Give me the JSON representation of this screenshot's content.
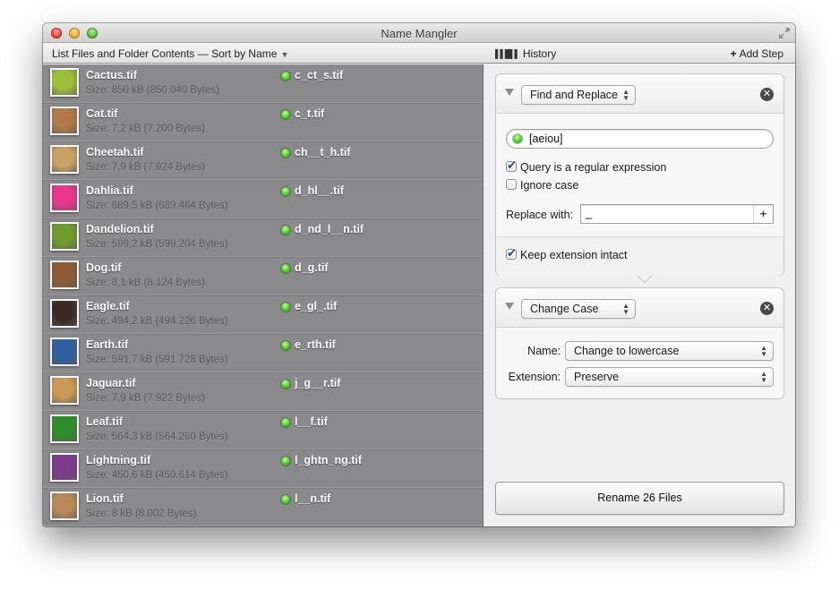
{
  "window": {
    "title": "Name Mangler",
    "controls": [
      "close",
      "minimize",
      "zoom"
    ],
    "fullscreen_icon": "fullscreen-arrows-icon"
  },
  "toolbar": {
    "sort_menu_label": "List Files and Folder Contents — Sort by Name",
    "history_label": "History",
    "add_step_label": "Add Step"
  },
  "files": [
    {
      "name": "Cactus.tif",
      "size": "Size: 850 kB (850.040 Bytes)",
      "new_name": "c_ct_s.tif",
      "thumb": "cactus",
      "status": "ok"
    },
    {
      "name": "Cat.tif",
      "size": "Size: 7,2 kB (7.200 Bytes)",
      "new_name": "c_t.tif",
      "thumb": "cat",
      "status": "ok"
    },
    {
      "name": "Cheetah.tif",
      "size": "Size: 7,9 kB (7.924 Bytes)",
      "new_name": "ch__t_h.tif",
      "thumb": "cheetah",
      "status": "ok"
    },
    {
      "name": "Dahlia.tif",
      "size": "Size: 689,5 kB (689.464 Bytes)",
      "new_name": "d_hl__.tif",
      "thumb": "dahlia",
      "status": "ok"
    },
    {
      "name": "Dandelion.tif",
      "size": "Size: 599,2 kB (599.204 Bytes)",
      "new_name": "d_nd_l__n.tif",
      "thumb": "dandelion",
      "status": "ok"
    },
    {
      "name": "Dog.tif",
      "size": "Size: 8,1 kB (8.124 Bytes)",
      "new_name": "d_g.tif",
      "thumb": "dog",
      "status": "ok"
    },
    {
      "name": "Eagle.tif",
      "size": "Size: 494,2 kB (494.226 Bytes)",
      "new_name": "e_gl_.tif",
      "thumb": "eagle",
      "status": "ok"
    },
    {
      "name": "Earth.tif",
      "size": "Size: 591,7 kB (591.728 Bytes)",
      "new_name": "e_rth.tif",
      "thumb": "earth",
      "status": "ok"
    },
    {
      "name": "Jaguar.tif",
      "size": "Size: 7,9 kB (7.922 Bytes)",
      "new_name": "j_g__r.tif",
      "thumb": "jaguar",
      "status": "ok"
    },
    {
      "name": "Leaf.tif",
      "size": "Size: 564,3 kB (564.260 Bytes)",
      "new_name": "l__f.tif",
      "thumb": "leaf",
      "status": "ok"
    },
    {
      "name": "Lightning.tif",
      "size": "Size: 450,6 kB (450.614 Bytes)",
      "new_name": "l_ghtn_ng.tif",
      "thumb": "lightning",
      "status": "ok"
    },
    {
      "name": "Lion.tif",
      "size": "Size: 8 kB (8.002 Bytes)",
      "new_name": "l__n.tif",
      "thumb": "lion",
      "status": "ok"
    }
  ],
  "thumb_colors": {
    "cactus": "#9bbf3a",
    "cat": "#b07a4a",
    "cheetah": "#c9a266",
    "dahlia": "#e8368c",
    "dandelion": "#6f9a2e",
    "dog": "#8c5a35",
    "eagle": "#3a2a22",
    "earth": "#2f5f9f",
    "jaguar": "#c99a55",
    "leaf": "#2f8d2a",
    "lightning": "#7a3b8a",
    "lion": "#b8895a"
  },
  "steps": {
    "find_replace": {
      "type_label": "Find and Replace",
      "query_value": "[aeiou]",
      "regex_label": "Query is a regular expression",
      "regex_checked": true,
      "ignore_case_label": "Ignore case",
      "ignore_case_checked": false,
      "replace_label": "Replace with:",
      "replace_value": "_",
      "keep_ext_label": "Keep extension intact",
      "keep_ext_checked": true
    },
    "change_case": {
      "type_label": "Change Case",
      "name_label": "Name:",
      "name_value": "Change to lowercase",
      "ext_label": "Extension:",
      "ext_value": "Preserve"
    }
  },
  "rename_button_label": "Rename 26 Files",
  "colors": {
    "list_bg": "#8a8a8c",
    "status_ok": "#4dc42a",
    "panel_bg": "#efefef"
  }
}
